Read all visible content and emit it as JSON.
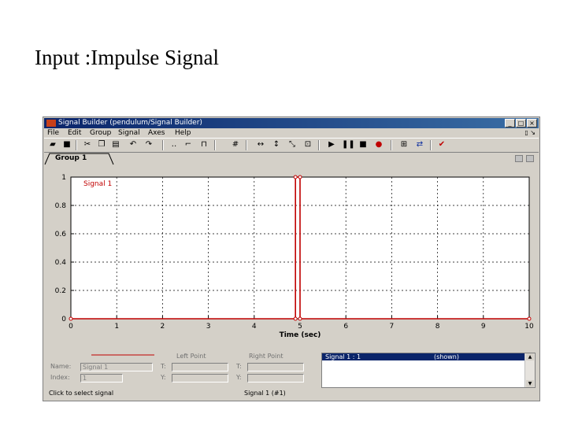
{
  "slide": {
    "title": "Input :Impulse Signal"
  },
  "window": {
    "title": "Signal Builder (pendulum/Signal Builder)",
    "controls": [
      "_",
      "□",
      "×"
    ]
  },
  "menu": {
    "items": [
      "File",
      "Edit",
      "Group",
      "Signal",
      "Axes",
      "Help"
    ]
  },
  "toolbar": {
    "icons": [
      "open-icon",
      "save-icon",
      "cut-icon",
      "copy-icon",
      "paste-icon",
      "undo-icon",
      "redo-icon",
      "constant-icon",
      "step-icon",
      "pulse-icon",
      "grid-icon",
      "zoom-x-icon",
      "zoom-y-icon",
      "zoom-xy-icon",
      "fit-icon",
      "play-icon",
      "pause-icon",
      "stop-icon",
      "record-icon",
      "model-icon",
      "link-icon",
      "close-red-icon"
    ]
  },
  "tab": {
    "label": "Group 1"
  },
  "chart_data": {
    "type": "line",
    "title": "",
    "xlabel": "Time (sec)",
    "ylabel": "",
    "xlim": [
      0,
      10
    ],
    "ylim": [
      0,
      1
    ],
    "x_ticks": [
      "0",
      "1",
      "2",
      "3",
      "4",
      "5",
      "6",
      "7",
      "8",
      "9",
      "10"
    ],
    "y_ticks": [
      "0",
      "0.2",
      "0.4",
      "0.6",
      "0.8",
      "1"
    ],
    "grid": true,
    "legend": "top-left",
    "series": [
      {
        "name": "Signal 1",
        "color": "#c00000",
        "x": [
          0,
          4.9,
          4.9,
          5,
          5,
          10
        ],
        "y": [
          0,
          0,
          1,
          1,
          0,
          0
        ]
      }
    ]
  },
  "bottom": {
    "left_point_label": "Left Point",
    "right_point_label": "Right Point",
    "name_label": "Name:",
    "name_value": "Signal 1",
    "index_label": "Index:",
    "index_value": "1",
    "t_label": "T:",
    "y_label": "Y:",
    "list_item": "Signal 1 : 1",
    "list_status": "(shown)",
    "status_left": "Click to select signal",
    "status_right": "Signal 1 (#1)"
  }
}
